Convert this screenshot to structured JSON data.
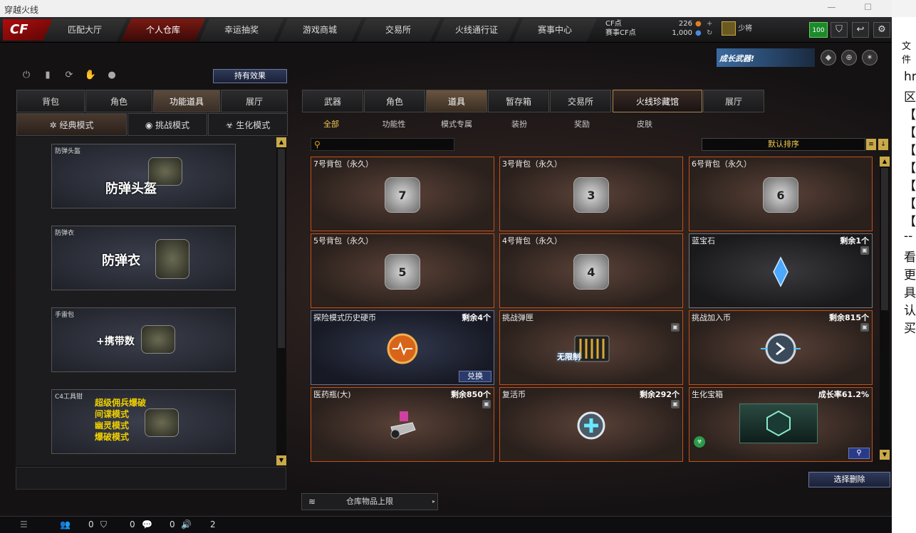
{
  "window": {
    "title": "穿越火线"
  },
  "nav": {
    "tabs": [
      "匹配大厅",
      "个人仓库",
      "幸运抽奖",
      "游戏商城",
      "交易所",
      "火线通行证",
      "赛事中心"
    ],
    "active": "个人仓库"
  },
  "logo": "CF",
  "currency": {
    "cf_label": "CF点",
    "cf_value": "226",
    "event_label": "赛事CF点",
    "event_value": "1,000"
  },
  "rank": {
    "label": "少将"
  },
  "level": "100",
  "promo": "成长武器!",
  "hold_effect": "持有效果",
  "left_tabs": [
    "背包",
    "角色",
    "功能道具",
    "展厅"
  ],
  "left_active": "功能道具",
  "mode_tabs": [
    "经典模式",
    "挑战模式",
    "生化模式"
  ],
  "mode_active": "经典模式",
  "left_cards": [
    {
      "name": "防弹头盔",
      "big": "防弹头盔"
    },
    {
      "name": "防弹衣",
      "big": "防弹衣"
    },
    {
      "name": "手雷包",
      "big": "+携带数"
    },
    {
      "name": "C4工具钳",
      "lines": [
        "超级佣兵爆破",
        "间谍模式",
        "幽灵模式",
        "爆破模式"
      ]
    }
  ],
  "right_tabs": [
    "武器",
    "角色",
    "道具",
    "暂存箱",
    "交易所",
    "火线珍藏馆",
    "展厅"
  ],
  "right_active": "道具",
  "sub_tabs": [
    "全部",
    "功能性",
    "模式专属",
    "装扮",
    "奖励",
    "皮肤"
  ],
  "sub_active": "全部",
  "sort_label": "默认排序",
  "items": [
    {
      "name": "7号背包（永久）",
      "remaining": "",
      "icon": "7"
    },
    {
      "name": "3号背包（永久）",
      "remaining": "",
      "icon": "3"
    },
    {
      "name": "6号背包（永久）",
      "remaining": "",
      "icon": "6"
    },
    {
      "name": "5号背包（永久）",
      "remaining": "",
      "icon": "5"
    },
    {
      "name": "4号背包（永久）",
      "remaining": "",
      "icon": "4"
    },
    {
      "name": "蓝宝石",
      "remaining": "剩余1个",
      "icon": "gem"
    },
    {
      "name": "探险模式历史硬币",
      "remaining": "剩余4个",
      "icon": "coin",
      "button": "兑换"
    },
    {
      "name": "挑战弹匣",
      "remaining": "",
      "icon": "ammo",
      "badge": "无限制"
    },
    {
      "name": "挑战加入币",
      "remaining": "剩余815个",
      "icon": "join"
    },
    {
      "name": "医药瓶(大)",
      "remaining": "剩余850个",
      "icon": "med"
    },
    {
      "name": "复活币",
      "remaining": "剩余292个",
      "icon": "revive"
    },
    {
      "name": "生化宝箱",
      "remaining": "成长率61.2%",
      "icon": "box"
    }
  ],
  "delete_button": "选择删除",
  "storage_limit": "仓库物品上限",
  "status": {
    "friends": "0",
    "shield": "0",
    "chat": "0",
    "volume": "2"
  },
  "side_window": {
    "title": "文件",
    "lines": [
      "hr",
      "区",
      "【",
      "【",
      "【",
      "【",
      "【",
      "【",
      "【",
      "--",
      "看",
      "更",
      "具",
      "认",
      "买"
    ]
  }
}
